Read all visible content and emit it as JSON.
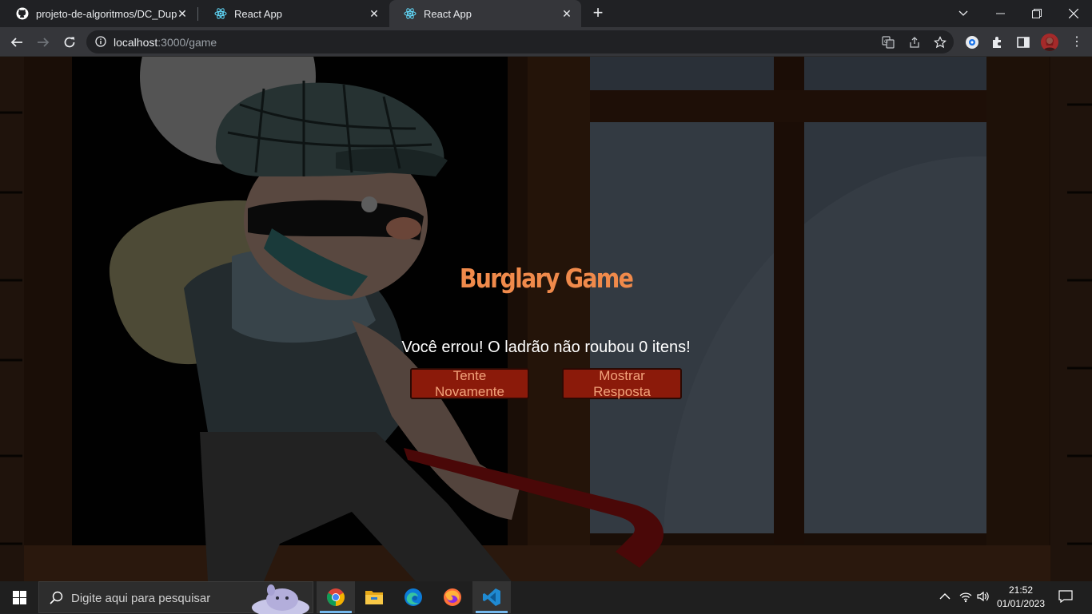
{
  "browser": {
    "tabs": [
      {
        "title": "projeto-de-algoritmos/DC_Dupla",
        "icon": "github-icon",
        "active": false
      },
      {
        "title": "React App",
        "icon": "react-icon",
        "active": false
      },
      {
        "title": "React App",
        "icon": "react-icon",
        "active": true
      }
    ],
    "url_host": "localhost",
    "url_path": ":3000/game"
  },
  "game": {
    "title": "Burglary Game",
    "message": "Você errou! O ladrão não roubou 0 itens!",
    "try_again_label": "Tente Novamente",
    "show_answer_label": "Mostrar Resposta"
  },
  "taskbar": {
    "search_placeholder": "Digite aqui para pesquisar",
    "time": "21:52",
    "date": "01/01/2023",
    "apps": [
      "chrome-icon",
      "file-explorer-icon",
      "edge-icon",
      "firefox-icon",
      "vscode-icon"
    ]
  },
  "colors": {
    "title": "#f08a4b",
    "button_bg": "#8b1a0a",
    "button_text": "#f2a27a",
    "background": "#1e120b"
  }
}
